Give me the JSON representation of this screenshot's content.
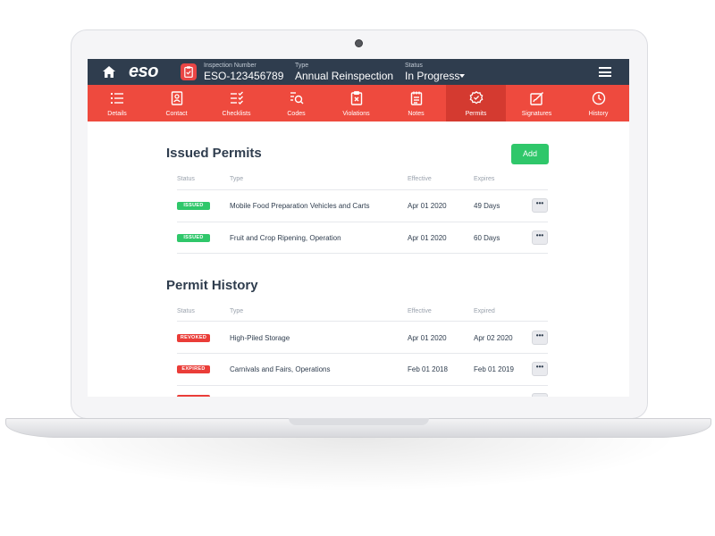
{
  "header": {
    "logo": "eso",
    "inspection_number_label": "Inspection Number",
    "inspection_number": "ESO-123456789",
    "type_label": "Type",
    "type_value": "Annual Reinspection",
    "status_label": "Status",
    "status_value": "In Progress"
  },
  "nav": {
    "items": [
      {
        "label": "Details",
        "icon": "list-icon"
      },
      {
        "label": "Contact",
        "icon": "contact-card-icon"
      },
      {
        "label": "Checklists",
        "icon": "checklist-icon"
      },
      {
        "label": "Codes",
        "icon": "code-search-icon"
      },
      {
        "label": "Violations",
        "icon": "violation-icon"
      },
      {
        "label": "Notes",
        "icon": "notes-icon"
      },
      {
        "label": "Permits",
        "icon": "permit-badge-icon"
      },
      {
        "label": "Signatures",
        "icon": "signature-icon"
      },
      {
        "label": "History",
        "icon": "clock-history-icon"
      }
    ],
    "active": "Permits"
  },
  "issued_permits": {
    "title": "Issued Permits",
    "add_label": "Add",
    "columns": [
      "Status",
      "Type",
      "Effective",
      "Expires"
    ],
    "rows": [
      {
        "status": "ISSUED",
        "type": "Mobile Food Preparation Vehicles and Carts",
        "effective": "Apr 01 2020",
        "expires": "49 Days"
      },
      {
        "status": "ISSUED",
        "type": "Fruit and Crop Ripening, Operation",
        "effective": "Apr 01 2020",
        "expires": "60 Days"
      }
    ]
  },
  "permit_history": {
    "title": "Permit History",
    "columns": [
      "Status",
      "Type",
      "Effective",
      "Expired"
    ],
    "rows": [
      {
        "status": "REVOKED",
        "type": "High-Piled Storage",
        "effective": "Apr 01 2020",
        "expired": "Apr 02 2020"
      },
      {
        "status": "EXPIRED",
        "type": "Carnivals and Fairs, Operations",
        "effective": "Feb 01 2018",
        "expired": "Feb 01 2019"
      }
    ]
  },
  "more_label": "•••",
  "colors": {
    "header_bg": "#2f3d4e",
    "nav_bg": "#ee4a3e",
    "nav_active_bg": "#d43a30",
    "issued": "#2fc76a",
    "revoked_expired": "#ea3d38",
    "add_button": "#2fc76a"
  }
}
